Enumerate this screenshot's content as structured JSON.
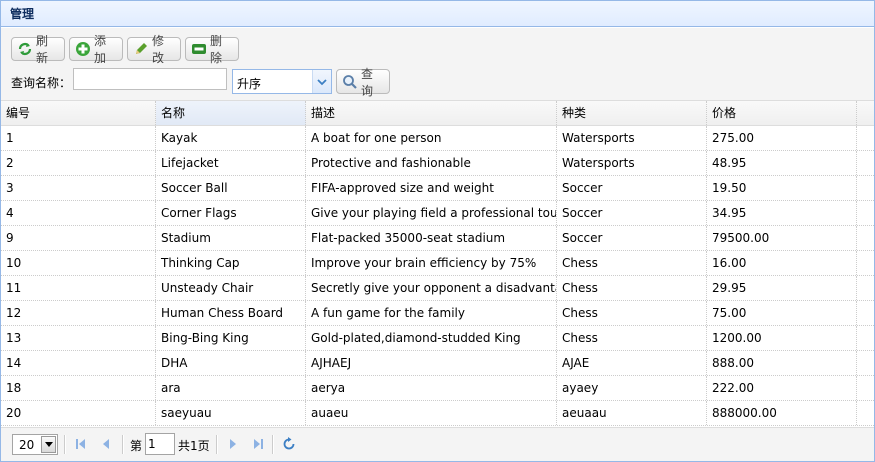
{
  "panel": {
    "title": "管理"
  },
  "toolbar": {
    "refresh_label": "刷新",
    "add_label": "添加",
    "edit_label": "修改",
    "delete_label": "删除",
    "search_label": "查询名称：",
    "search_value": "",
    "order_value": "升序",
    "search_button_label": "查询"
  },
  "grid": {
    "columns": [
      "编号",
      "名称",
      "描述",
      "种类",
      "价格"
    ],
    "rows": [
      [
        "1",
        "Kayak",
        "A boat for one person",
        "Watersports",
        "275.00"
      ],
      [
        "2",
        "Lifejacket",
        "Protective and fashionable",
        "Watersports",
        "48.95"
      ],
      [
        "3",
        "Soccer Ball",
        "FIFA-approved size and weight",
        "Soccer",
        "19.50"
      ],
      [
        "4",
        "Corner Flags",
        "Give your playing field a professional touch",
        "Soccer",
        "34.95"
      ],
      [
        "9",
        "Stadium",
        "Flat-packed 35000-seat stadium",
        "Soccer",
        "79500.00"
      ],
      [
        "10",
        "Thinking Cap",
        "Improve your brain efficiency by 75%",
        "Chess",
        "16.00"
      ],
      [
        "11",
        "Unsteady Chair",
        "Secretly give your opponent a disadvantage",
        "Chess",
        "29.95"
      ],
      [
        "12",
        "Human Chess Board",
        "A fun game for the family",
        "Chess",
        "75.00"
      ],
      [
        "13",
        "Bing-Bing King",
        "Gold-plated,diamond-studded King",
        "Chess",
        "1200.00"
      ],
      [
        "14",
        "DHA",
        "AJHAEJ",
        "AJAE",
        "888.00"
      ],
      [
        "18",
        "ara",
        "aerya",
        "ayaey",
        "222.00"
      ],
      [
        "20",
        "saeyuau",
        "auaeu",
        "aeuaau",
        "888000.00"
      ]
    ]
  },
  "pager": {
    "page_size": "20",
    "page_prefix": "第",
    "current_page": "1",
    "page_total": "共1页"
  },
  "colors": {
    "panel_border": "#95b8e7",
    "header_text": "#0e2d5f",
    "icon_blue": "#3c7fc4"
  }
}
